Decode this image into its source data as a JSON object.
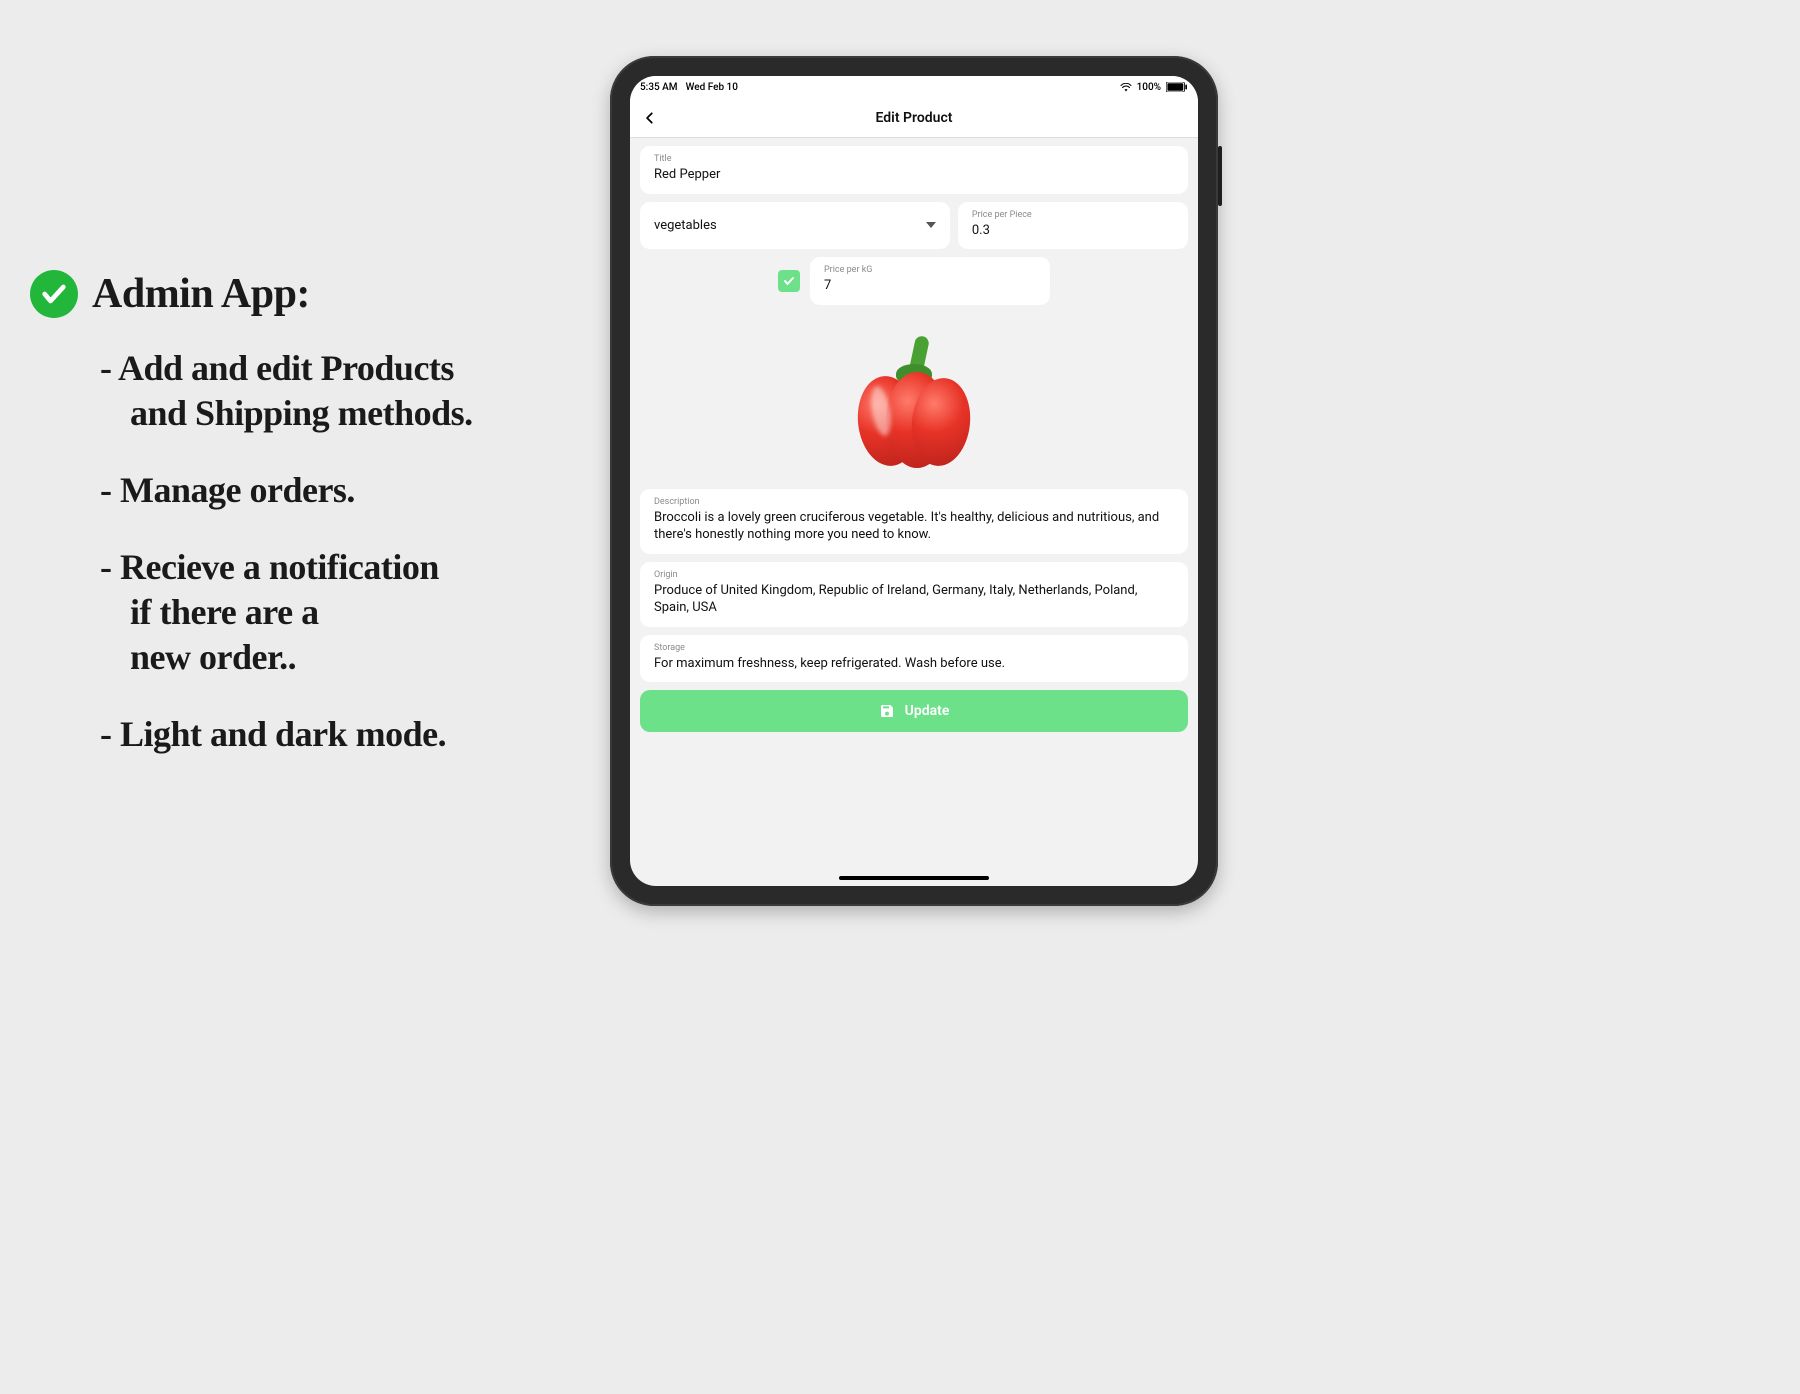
{
  "marketing": {
    "headline": "Admin App:",
    "bullets": [
      [
        "- Add and edit Products",
        "and Shipping methods."
      ],
      [
        "- Manage orders."
      ],
      [
        "- Recieve a notification",
        "if there are a",
        "new order.."
      ],
      [
        "- Light and dark mode."
      ]
    ]
  },
  "status": {
    "time": "5:35 AM",
    "date": "Wed Feb 10",
    "battery_text": "100%"
  },
  "nav": {
    "title": "Edit Product"
  },
  "form": {
    "title_label": "Title",
    "title_value": "Red Pepper",
    "category_value": "vegetables",
    "price_piece_label": "Price per Piece",
    "price_piece_value": "0.3",
    "price_kg_label": "Price per kG",
    "price_kg_value": "7",
    "price_kg_enabled": true,
    "description_label": "Description",
    "description_value": "Broccoli is a lovely green cruciferous vegetable. It's healthy, delicious and nutritious, and there's honestly nothing more you need to know.",
    "origin_label": "Origin",
    "origin_value": "Produce of United Kingdom, Republic of Ireland, Germany, Italy, Netherlands, Poland, Spain, USA",
    "storage_label": "Storage",
    "storage_value": "For maximum freshness, keep refrigerated. Wash before use.",
    "update_label": "Update"
  },
  "colors": {
    "accent_green": "#6de08a",
    "badge_green": "#22b63a"
  }
}
